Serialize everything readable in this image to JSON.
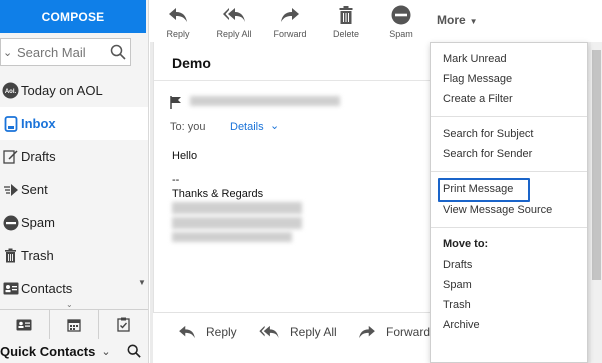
{
  "compose_label": "COMPOSE",
  "search": {
    "placeholder": "Search Mail"
  },
  "nav": [
    {
      "label": "Today on AOL",
      "icon": "aol-icon"
    },
    {
      "label": "Inbox",
      "icon": "inbox-icon",
      "active": true
    },
    {
      "label": "Drafts",
      "icon": "drafts-icon"
    },
    {
      "label": "Sent",
      "icon": "sent-icon"
    },
    {
      "label": "Spam",
      "icon": "spam-icon"
    },
    {
      "label": "Trash",
      "icon": "trash-icon"
    },
    {
      "label": "Contacts",
      "icon": "contacts-icon"
    }
  ],
  "quick_contacts": "Quick Contacts",
  "toolbar": {
    "reply": "Reply",
    "reply_all": "Reply All",
    "forward": "Forward",
    "delete": "Delete",
    "spam": "Spam",
    "more": "More"
  },
  "message": {
    "subject": "Demo",
    "to": "To: you",
    "details": "Details",
    "hello": "Hello",
    "dashes": "--",
    "thanks": "Thanks & Regards"
  },
  "reply_bar": {
    "reply": "Reply",
    "reply_all": "Reply All",
    "forward": "Forward"
  },
  "menu": {
    "group1": [
      "Mark Unread",
      "Flag Message",
      "Create a Filter"
    ],
    "group2": [
      "Search for Subject",
      "Search for Sender"
    ],
    "group3": [
      "Print Message",
      "View Message Source"
    ],
    "move_to_heading": "Move to:",
    "move_to": [
      "Drafts",
      "Spam",
      "Trash",
      "Archive"
    ]
  },
  "colors": {
    "accent": "#0f7fe8",
    "active_nav": "#1a73d9",
    "highlight": "#1a64c9"
  }
}
